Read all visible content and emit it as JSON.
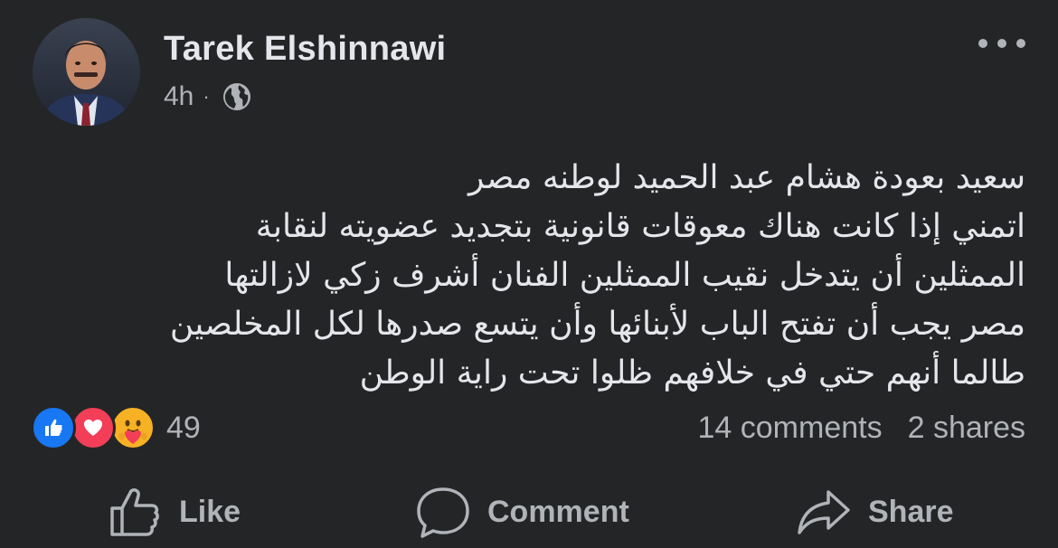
{
  "post": {
    "author": "Tarek Elshinnawi",
    "time": "4h",
    "separator": "·",
    "privacy_icon": "globe-icon",
    "more_icon": "more-horizontal-icon",
    "text_lines": [
      "سعيد بعودة هشام عبد الحميد لوطنه مصر",
      "اتمني إذا كانت هناك معوقات قانونية بتجديد عضويته لنقابة",
      "الممثلين أن يتدخل نقيب الممثلين الفنان أشرف زكي لازالتها",
      "مصر يجب أن تفتح الباب لأبنائها وأن يتسع صدرها لكل المخلصين",
      "طالما أنهم حتي في خلافهم ظلوا تحت راية الوطن"
    ]
  },
  "reactions": {
    "types": [
      "like-icon",
      "love-icon",
      "care-icon"
    ],
    "count": "49"
  },
  "stats": {
    "comments": "14 comments",
    "shares": "2 shares"
  },
  "actions": {
    "like": "Like",
    "comment": "Comment",
    "share": "Share"
  },
  "colors": {
    "background": "#242526",
    "primary_text": "#e4e6eb",
    "secondary_text": "#b0b3b8",
    "like_blue": "#1877f2",
    "love_red": "#f33e58",
    "care_yellow": "#f7b125"
  }
}
